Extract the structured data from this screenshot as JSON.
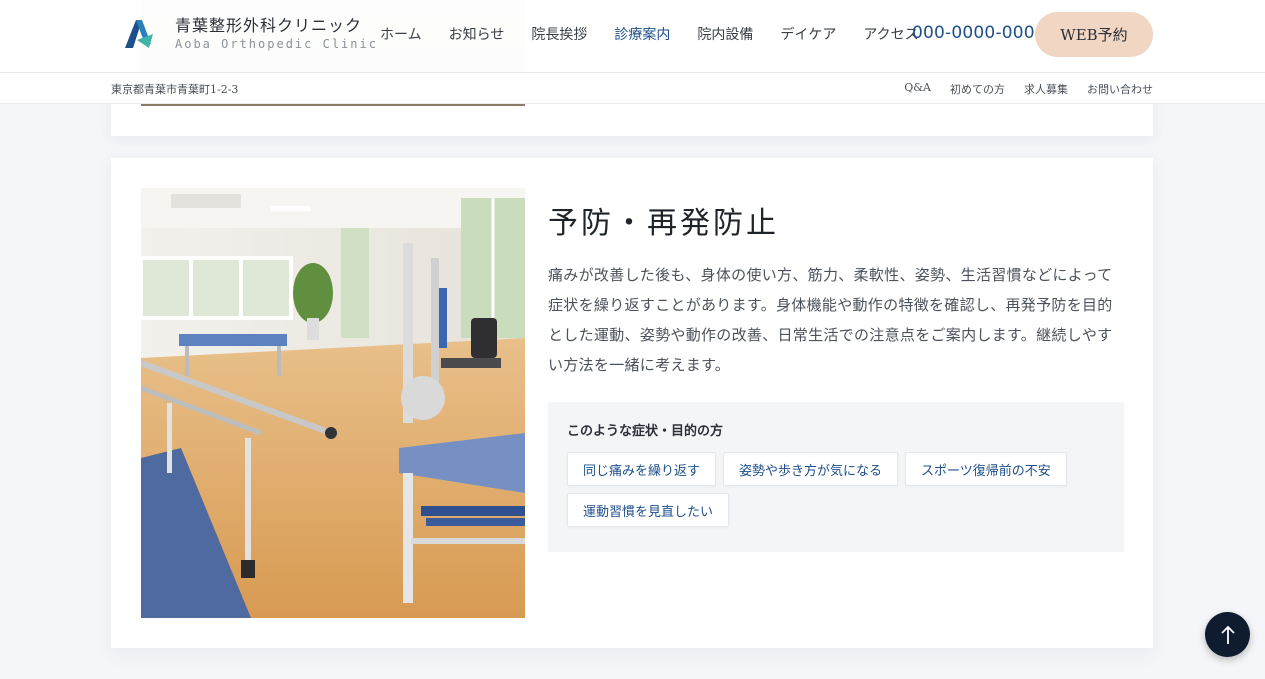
{
  "header": {
    "logo_ja": "青葉整形外科クリニック",
    "logo_en": "Aoba Orthopedic Clinic",
    "nav": [
      {
        "label": "ホーム"
      },
      {
        "label": "お知らせ"
      },
      {
        "label": "院長挨拶"
      },
      {
        "label": "診療案内"
      },
      {
        "label": "院内設備"
      },
      {
        "label": "デイケア"
      },
      {
        "label": "アクセス"
      }
    ],
    "active_nav": "診療案内",
    "phone": "000-0000-0000",
    "web_button": "WEB予約"
  },
  "subbar": {
    "address": "東京都青葉市青葉町1-2-3",
    "links": [
      {
        "label": "Q&A"
      },
      {
        "label": "初めての方"
      },
      {
        "label": "求人募集"
      },
      {
        "label": "お問い合わせ"
      }
    ]
  },
  "section": {
    "title": "予防・再発防止",
    "description": "痛みが改善した後も、身体の使い方、筋力、柔軟性、姿勢、生活習慣などによって症状を繰り返すことがあります。身体機能や動作の特徴を確認し、再発予防を目的とした運動、姿勢や動作の改善、日常生活での注意点をご案内します。継続しやすい方法を一緒に考えます。",
    "symptoms_title": "このような症状・目的の方",
    "tags": [
      {
        "label": "同じ痛みを繰り返す"
      },
      {
        "label": "姿勢や歩き方が気になる"
      },
      {
        "label": "スポーツ復帰前の不安"
      },
      {
        "label": "運動習慣を見直したい"
      }
    ]
  },
  "colors": {
    "accent": "#1d4f8a",
    "button_bg": "#f1d6c4",
    "to_top_bg": "#0f1b2e",
    "page_bg": "#f4f6f9"
  },
  "icons": {
    "logo": "clinic-logo-icon",
    "to_top": "arrow-up-icon"
  }
}
